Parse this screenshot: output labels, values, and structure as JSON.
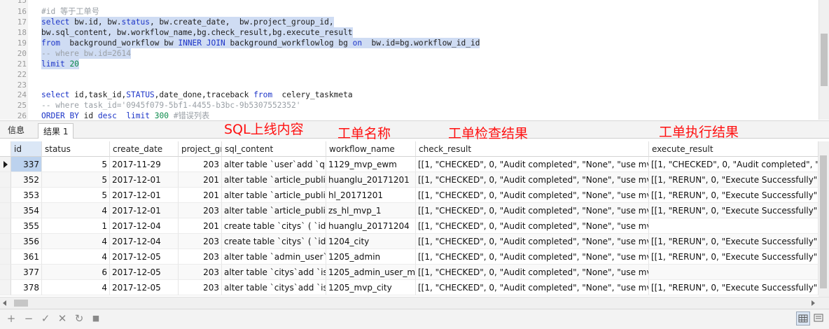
{
  "editor": {
    "lines": [
      {
        "num": "15",
        "text": ""
      },
      {
        "num": "16",
        "text": "#id 等于工单号"
      },
      {
        "num": "17",
        "text": "select bw.id, bw.status, bw.create_date,  bw.project_group_id,"
      },
      {
        "num": "18",
        "text": "bw.sql_content, bw.workflow_name,bg.check_result,bg.execute_result"
      },
      {
        "num": "19",
        "text": "from  background_workflow bw INNER JOIN background_workflowlog bg on  bw.id=bg.workflow_id_id"
      },
      {
        "num": "20",
        "text": "-- where bw.id=2614"
      },
      {
        "num": "21",
        "text": "limit 20"
      },
      {
        "num": "22",
        "text": ""
      },
      {
        "num": "23",
        "text": ""
      },
      {
        "num": "24",
        "text": "select id,task_id,STATUS,date_done,traceback from  celery_taskmeta"
      },
      {
        "num": "25",
        "text": "-- where task_id='0945f079-5bf1-4455-b3bc-9b5307552352'"
      },
      {
        "num": "26",
        "text": "ORDER BY id desc  limit 300 #错误列表"
      }
    ]
  },
  "tabs": [
    {
      "label": "信息",
      "active": false
    },
    {
      "label": "结果 1",
      "active": true
    }
  ],
  "annotations": [
    {
      "text": "SQL上线内容"
    },
    {
      "text": "工单名称"
    },
    {
      "text": "工单检查结果"
    },
    {
      "text": "工单执行结果"
    }
  ],
  "grid": {
    "columns": [
      "id",
      "status",
      "create_date",
      "project_gr",
      "sql_content",
      "workflow_name",
      "check_result",
      "execute_result"
    ],
    "rows": [
      [
        "337",
        "5",
        "2017-11-29",
        "203",
        "alter table `user`add `qrc",
        "1129_mvp_ewm",
        "[[1, \"CHECKED\", 0, \"Audit completed\", \"None\", \"use mvp_",
        "[[1, \"CHECKED\", 0, \"Audit completed\", \"N"
      ],
      [
        "352",
        "5",
        "2017-12-01",
        "201",
        "alter table `article_publish",
        "huanglu_20171201",
        "[[1, \"CHECKED\", 0, \"Audit completed\", \"None\", \"use mvp_",
        "[[1, \"RERUN\", 0, \"Execute Successfully\", \"N"
      ],
      [
        "353",
        "5",
        "2017-12-01",
        "201",
        "alter table `article_publish",
        "hl_20171201",
        "[[1, \"CHECKED\", 0, \"Audit completed\", \"None\", \"use mvp_",
        "[[1, \"RERUN\", 0, \"Execute Successfully\", \"N"
      ],
      [
        "354",
        "4",
        "2017-12-01",
        "203",
        "alter table `article_publish",
        "zs_hl_mvp_1",
        "[[1, \"CHECKED\", 0, \"Audit completed\", \"None\", \"use mvp_",
        "[[1, \"RERUN\", 0, \"Execute Successfully\", \"N"
      ],
      [
        "355",
        "1",
        "2017-12-04",
        "201",
        "create table `citys` ( `id`",
        "huanglu_20171204",
        "[[1, \"CHECKED\", 0, \"Audit completed\", \"None\", \"use mvp_",
        ""
      ],
      [
        "356",
        "4",
        "2017-12-04",
        "203",
        "create table `citys` ( `id`",
        "1204_city",
        "[[1, \"CHECKED\", 0, \"Audit completed\", \"None\", \"use mvp_",
        "[[1, \"RERUN\", 0, \"Execute Successfully\", \"N"
      ],
      [
        "361",
        "4",
        "2017-12-05",
        "203",
        "alter table `admin_user`ac",
        "1205_admin",
        "[[1, \"CHECKED\", 0, \"Audit completed\", \"None\", \"use mvp_",
        "[[1, \"RERUN\", 0, \"Execute Successfully\", \"N"
      ],
      [
        "377",
        "6",
        "2017-12-05",
        "203",
        "alter table `citys`add `is_c",
        "1205_admin_user_mvp",
        "[[1, \"CHECKED\", 0, \"Audit completed\", \"None\", \"use mvp_",
        ""
      ],
      [
        "378",
        "4",
        "2017-12-05",
        "203",
        "alter table `citys`add `is_c",
        "1205_mvp_city",
        "[[1, \"CHECKED\", 0, \"Audit completed\", \"None\", \"use mvp_",
        "[[1, \"RERUN\", 0, \"Execute Successfully\", \"N"
      ]
    ],
    "selected_row": 0
  },
  "toolbar": {
    "buttons": [
      {
        "icon": "plus-icon",
        "glyph": "+"
      },
      {
        "icon": "minus-icon",
        "glyph": "−"
      },
      {
        "icon": "check-icon",
        "glyph": "✓"
      },
      {
        "icon": "cross-icon",
        "glyph": "✕"
      },
      {
        "icon": "refresh-icon",
        "glyph": "↻"
      },
      {
        "icon": "stop-icon",
        "glyph": "■"
      }
    ],
    "view_buttons": [
      {
        "icon": "grid-view-icon",
        "active": true
      },
      {
        "icon": "form-view-icon",
        "active": false
      }
    ]
  },
  "colors": {
    "annotation": "#ff1010",
    "keyword": "#1d35c8",
    "comment": "#9aa0a6",
    "string": "#8a1b4a",
    "number": "#0a8a4a",
    "selection": "#cfdcf3",
    "current_id_cell": "#bcd2ee"
  }
}
